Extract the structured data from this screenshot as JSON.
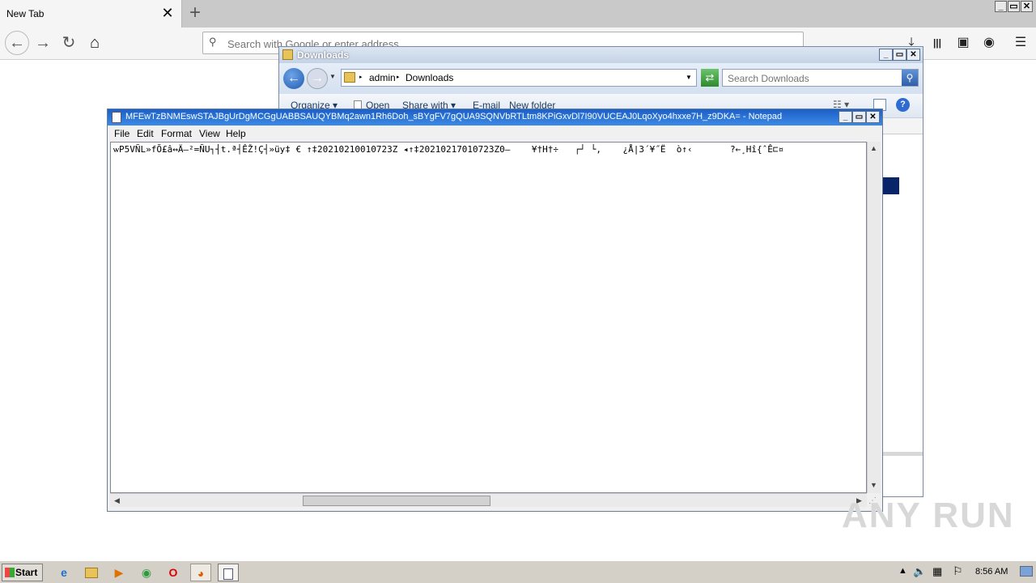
{
  "browser": {
    "tab_title": "New Tab",
    "tab_close": "✕",
    "new_tab": "+",
    "url_placeholder": "Search with Google or enter address",
    "icons": {
      "back": "←",
      "forward": "→",
      "reload": "↻",
      "home": "⌂",
      "downloads": "⤓",
      "library": "|||",
      "sidebar": "▣",
      "account": "◉",
      "menu": "☰",
      "search": "🔍"
    },
    "window_controls": {
      "minimize": "_",
      "maximize": "▭",
      "close": "✕"
    }
  },
  "explorer": {
    "title": "Downloads",
    "breadcrumb": [
      "admin",
      "Downloads"
    ],
    "search_placeholder": "Search Downloads",
    "commands": [
      "Organize ▾",
      "Open",
      "Share with ▾",
      "E-mail",
      "New folder"
    ],
    "window_controls": {
      "minimize": "_",
      "maximize": "▭",
      "close": "✕"
    }
  },
  "notepad": {
    "title": "MFEwTzBNMEswSTAJBgUrDgMCGgUABBSAUQYBMq2awn1Rh6Doh_sBYgFV7gQUA9SQNVbRTLtm8KPiGxvDl7I90VUCEAJ0LqoXyo4hxxe7H_z9DKA= - Notepad",
    "menus": [
      "File",
      "Edit",
      "Format",
      "View",
      "Help"
    ],
    "content": "ѡP5VÑL»fÕ£â↔Ä—²=ÑU┐┤t.ª┤ÊŽ!Ç┤»üy‡ € ↑‡20210210010723Z ◂↑‡20210217010723Z0—    ¥†H†÷   ┌┘ └,    ¿Å|3´¥˝Ë  ò↑‹       ?←¸Hî{ˆÊ⊏¤",
    "window_controls": {
      "minimize": "_",
      "maximize": "▭",
      "close": "✕"
    }
  },
  "taskbar": {
    "start_label": "Start",
    "apps": [
      "ie-icon",
      "explorer-icon",
      "media-icon",
      "chrome-icon",
      "opera-icon",
      "firefox-icon",
      "notepad-icon"
    ],
    "clock": "8:56 AM"
  },
  "watermark": "ANY RUN"
}
